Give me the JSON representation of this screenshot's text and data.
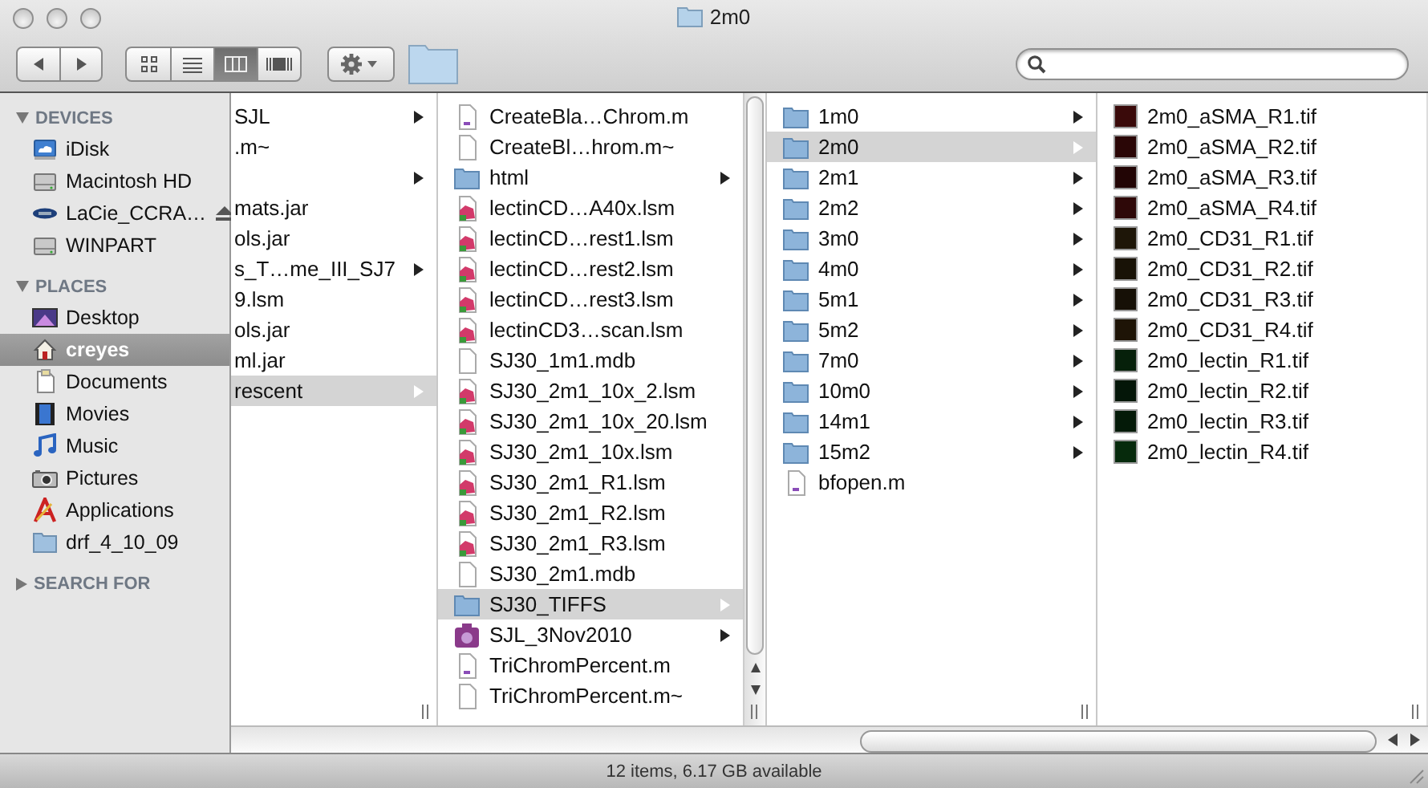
{
  "window": {
    "title": "2m0"
  },
  "toolbar": {
    "view_modes": [
      {
        "kind": "icons",
        "selected": false
      },
      {
        "kind": "list",
        "selected": false
      },
      {
        "kind": "columns",
        "selected": true
      },
      {
        "kind": "coverflow",
        "selected": false
      }
    ]
  },
  "sidebar": {
    "sections": [
      {
        "title": "DEVICES",
        "expanded": true,
        "items": [
          {
            "label": "iDisk",
            "kind": "idisk",
            "selected": false
          },
          {
            "label": "Macintosh HD",
            "kind": "disk",
            "selected": false
          },
          {
            "label": "LaCie_CCRA…",
            "kind": "lacie",
            "selected": false,
            "ejectable": true
          },
          {
            "label": "WINPART",
            "kind": "disk",
            "selected": false
          }
        ]
      },
      {
        "title": "PLACES",
        "expanded": true,
        "items": [
          {
            "label": "Desktop",
            "kind": "desktop",
            "selected": false
          },
          {
            "label": "creyes",
            "kind": "home",
            "selected": true
          },
          {
            "label": "Documents",
            "kind": "documents",
            "selected": false
          },
          {
            "label": "Movies",
            "kind": "movies",
            "selected": false
          },
          {
            "label": "Music",
            "kind": "music",
            "selected": false
          },
          {
            "label": "Pictures",
            "kind": "pictures",
            "selected": false
          },
          {
            "label": "Applications",
            "kind": "applications",
            "selected": false
          },
          {
            "label": "drf_4_10_09",
            "kind": "folder",
            "selected": false
          }
        ]
      },
      {
        "title": "SEARCH FOR",
        "expanded": false
      }
    ]
  },
  "columns": [
    {
      "items": [
        {
          "name": "SJL",
          "kind": "none",
          "expandable": true,
          "selected": false
        },
        {
          "name": ".m~",
          "kind": "none",
          "expandable": false,
          "selected": false
        },
        {
          "kind": "none",
          "expandable": true,
          "selected": false
        },
        {
          "name": "mats.jar",
          "kind": "none",
          "expandable": false,
          "selected": false
        },
        {
          "name": "ols.jar",
          "kind": "none",
          "expandable": false,
          "selected": false
        },
        {
          "name": "s_T…me_III_SJ7",
          "kind": "none",
          "expandable": true,
          "selected": false
        },
        {
          "name": "9.lsm",
          "kind": "none",
          "expandable": false,
          "selected": false
        },
        {
          "name": "ols.jar",
          "kind": "none",
          "expandable": false,
          "selected": false
        },
        {
          "name": "ml.jar",
          "kind": "none",
          "expandable": false,
          "selected": false
        },
        {
          "name": "rescent",
          "kind": "none",
          "expandable": true,
          "selected": true
        }
      ]
    },
    {
      "scrollbar": true,
      "items": [
        {
          "name": "CreateBla…Chrom.m",
          "kind": "mfile",
          "expandable": false,
          "selected": false
        },
        {
          "name": "CreateBl…hrom.m~",
          "kind": "doc",
          "expandable": false,
          "selected": false
        },
        {
          "name": "html",
          "kind": "folder",
          "expandable": true,
          "selected": false
        },
        {
          "name": "lectinCD…A40x.lsm",
          "kind": "lsm",
          "expandable": false,
          "selected": false
        },
        {
          "name": "lectinCD…rest1.lsm",
          "kind": "lsm",
          "expandable": false,
          "selected": false
        },
        {
          "name": "lectinCD…rest2.lsm",
          "kind": "lsm",
          "expandable": false,
          "selected": false
        },
        {
          "name": "lectinCD…rest3.lsm",
          "kind": "lsm",
          "expandable": false,
          "selected": false
        },
        {
          "name": "lectinCD3…scan.lsm",
          "kind": "lsm",
          "expandable": false,
          "selected": false
        },
        {
          "name": "SJ30_1m1.mdb",
          "kind": "doc",
          "expandable": false,
          "selected": false
        },
        {
          "name": "SJ30_2m1_10x_2.lsm",
          "kind": "lsm",
          "expandable": false,
          "selected": false
        },
        {
          "name": "SJ30_2m1_10x_20.lsm",
          "kind": "lsm",
          "expandable": false,
          "selected": false
        },
        {
          "name": "SJ30_2m1_10x.lsm",
          "kind": "lsm",
          "expandable": false,
          "selected": false
        },
        {
          "name": "SJ30_2m1_R1.lsm",
          "kind": "lsm",
          "expandable": false,
          "selected": false
        },
        {
          "name": "SJ30_2m1_R2.lsm",
          "kind": "lsm",
          "expandable": false,
          "selected": false
        },
        {
          "name": "SJ30_2m1_R3.lsm",
          "kind": "lsm",
          "expandable": false,
          "selected": false
        },
        {
          "name": "SJ30_2m1.mdb",
          "kind": "doc",
          "expandable": false,
          "selected": false
        },
        {
          "name": "SJ30_TIFFS",
          "kind": "folder",
          "expandable": true,
          "selected": true
        },
        {
          "name": "SJL_3Nov2010",
          "kind": "app",
          "expandable": true,
          "selected": false
        },
        {
          "name": "TriChromPercent.m",
          "kind": "mfile",
          "expandable": false,
          "selected": false
        },
        {
          "name": "TriChromPercent.m~",
          "kind": "doc",
          "expandable": false,
          "selected": false
        }
      ]
    },
    {
      "items": [
        {
          "name": "1m0",
          "kind": "folder",
          "expandable": true,
          "selected": false
        },
        {
          "name": "2m0",
          "kind": "folder",
          "expandable": true,
          "selected": true
        },
        {
          "name": "2m1",
          "kind": "folder",
          "expandable": true,
          "selected": false
        },
        {
          "name": "2m2",
          "kind": "folder",
          "expandable": true,
          "selected": false
        },
        {
          "name": "3m0",
          "kind": "folder",
          "expandable": true,
          "selected": false
        },
        {
          "name": "4m0",
          "kind": "folder",
          "expandable": true,
          "selected": false
        },
        {
          "name": "5m1",
          "kind": "folder",
          "expandable": true,
          "selected": false
        },
        {
          "name": "5m2",
          "kind": "folder",
          "expandable": true,
          "selected": false
        },
        {
          "name": "7m0",
          "kind": "folder",
          "expandable": true,
          "selected": false
        },
        {
          "name": "10m0",
          "kind": "folder",
          "expandable": true,
          "selected": false
        },
        {
          "name": "14m1",
          "kind": "folder",
          "expandable": true,
          "selected": false
        },
        {
          "name": "15m2",
          "kind": "folder",
          "expandable": true,
          "selected": false
        },
        {
          "name": "bfopen.m",
          "kind": "mfile",
          "expandable": false,
          "selected": false
        }
      ]
    },
    {
      "items": [
        {
          "name": "2m0_aSMA_R1.tif",
          "kind": "tif",
          "color": "#3a0a0a",
          "expandable": false,
          "selected": false
        },
        {
          "name": "2m0_aSMA_R2.tif",
          "kind": "tif",
          "color": "#2a0606",
          "expandable": false,
          "selected": false
        },
        {
          "name": "2m0_aSMA_R3.tif",
          "kind": "tif",
          "color": "#220505",
          "expandable": false,
          "selected": false
        },
        {
          "name": "2m0_aSMA_R4.tif",
          "kind": "tif",
          "color": "#2e0808",
          "expandable": false,
          "selected": false
        },
        {
          "name": "2m0_CD31_R1.tif",
          "kind": "tif",
          "color": "#1e1608",
          "expandable": false,
          "selected": false
        },
        {
          "name": "2m0_CD31_R2.tif",
          "kind": "tif",
          "color": "#181206",
          "expandable": false,
          "selected": false
        },
        {
          "name": "2m0_CD31_R3.tif",
          "kind": "tif",
          "color": "#161006",
          "expandable": false,
          "selected": false
        },
        {
          "name": "2m0_CD31_R4.tif",
          "kind": "tif",
          "color": "#1e1406",
          "expandable": false,
          "selected": false
        },
        {
          "name": "2m0_lectin_R1.tif",
          "kind": "tif",
          "color": "#06200a",
          "expandable": false,
          "selected": false
        },
        {
          "name": "2m0_lectin_R2.tif",
          "kind": "tif",
          "color": "#041608",
          "expandable": false,
          "selected": false
        },
        {
          "name": "2m0_lectin_R3.tif",
          "kind": "tif",
          "color": "#041a08",
          "expandable": false,
          "selected": false
        },
        {
          "name": "2m0_lectin_R4.tif",
          "kind": "tif",
          "color": "#062a0c",
          "expandable": false,
          "selected": false
        }
      ]
    }
  ],
  "status_bar": {
    "text": "12 items, 6.17 GB available"
  }
}
